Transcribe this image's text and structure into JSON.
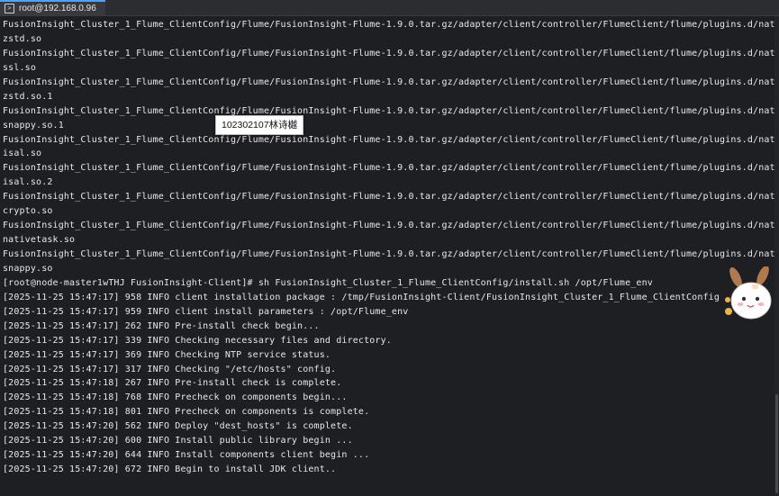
{
  "tab": {
    "title": "root@192.168.0.96",
    "icon": "terminal-icon"
  },
  "tooltip": {
    "text": "102302107林诗樾"
  },
  "terminal": {
    "lines": [
      "FusionInsight_Cluster_1_Flume_ClientConfig/Flume/FusionInsight-Flume-1.9.0.tar.gz/adapter/client/controller/FlumeClient/flume/plugins.d/native/native/lib",
      "zstd.so",
      "FusionInsight_Cluster_1_Flume_ClientConfig/Flume/FusionInsight-Flume-1.9.0.tar.gz/adapter/client/controller/FlumeClient/flume/plugins.d/native/native/lib",
      "ssl.so",
      "FusionInsight_Cluster_1_Flume_ClientConfig/Flume/FusionInsight-Flume-1.9.0.tar.gz/adapter/client/controller/FlumeClient/flume/plugins.d/native/native/lib",
      "zstd.so.1",
      "FusionInsight_Cluster_1_Flume_ClientConfig/Flume/FusionInsight-Flume-1.9.0.tar.gz/adapter/client/controller/FlumeClient/flume/plugins.d/native/native/lib",
      "snappy.so.1",
      "FusionInsight_Cluster_1_Flume_ClientConfig/Flume/FusionInsight-Flume-1.9.0.tar.gz/adapter/client/controller/FlumeClient/flume/plugins.d/native/native/lib",
      "isal.so",
      "FusionInsight_Cluster_1_Flume_ClientConfig/Flume/FusionInsight-Flume-1.9.0.tar.gz/adapter/client/controller/FlumeClient/flume/plugins.d/native/native/lib",
      "isal.so.2",
      "FusionInsight_Cluster_1_Flume_ClientConfig/Flume/FusionInsight-Flume-1.9.0.tar.gz/adapter/client/controller/FlumeClient/flume/plugins.d/native/native/lib",
      "crypto.so",
      "FusionInsight_Cluster_1_Flume_ClientConfig/Flume/FusionInsight-Flume-1.9.0.tar.gz/adapter/client/controller/FlumeClient/flume/plugins.d/native/native/lib",
      "nativetask.so",
      "FusionInsight_Cluster_1_Flume_ClientConfig/Flume/FusionInsight-Flume-1.9.0.tar.gz/adapter/client/controller/FlumeClient/flume/plugins.d/native/native/lib",
      "snappy.so",
      "[root@node-master1wTHJ FusionInsight-Client]# sh FusionInsight_Cluster_1_Flume_ClientConfig/install.sh /opt/Flume_env",
      "[2025-11-25 15:47:17] 958 INFO client installation package : /tmp/FusionInsight-Client/FusionInsight_Cluster_1_Flume_ClientConfig",
      "[2025-11-25 15:47:17] 959 INFO client install parameters : /opt/Flume_env",
      "[2025-11-25 15:47:17] 262 INFO Pre-install check begin...",
      "[2025-11-25 15:47:17] 339 INFO Checking necessary files and directory.",
      "[2025-11-25 15:47:17] 369 INFO Checking NTP service status.",
      "[2025-11-25 15:47:17] 317 INFO Checking \"/etc/hosts\" config.",
      "[2025-11-25 15:47:18] 267 INFO Pre-install check is complete.",
      "[2025-11-25 15:47:18] 768 INFO Precheck on components begin...",
      "[2025-11-25 15:47:18] 801 INFO Precheck on components is complete.",
      "[2025-11-25 15:47:20] 562 INFO Deploy \"dest_hosts\" is complete.",
      "[2025-11-25 15:47:20] 600 INFO Install public library begin ...",
      "[2025-11-25 15:47:20] 644 INFO Install components client begin ...",
      "[2025-11-25 15:47:20] 672 INFO Begin to install JDK client.."
    ]
  },
  "colors": {
    "background": "#1e1f22",
    "text": "#e8e8e8",
    "tab_accent": "#4aa3ff"
  }
}
